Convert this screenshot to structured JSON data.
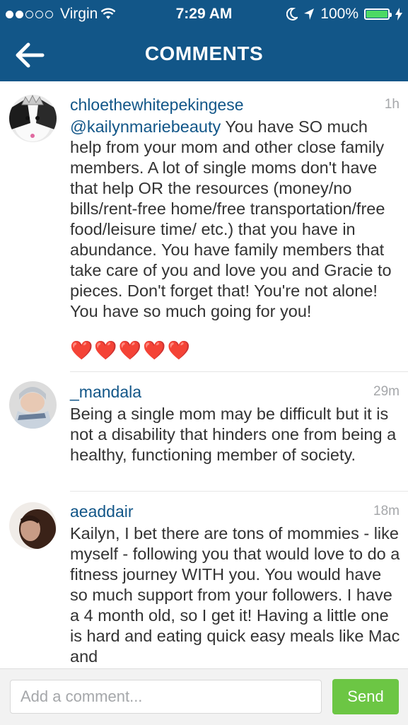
{
  "status_bar": {
    "carrier": "Virgin",
    "time": "7:29 AM",
    "battery": "100%",
    "battery_level": 1.0,
    "signal_dots": 5,
    "signal_filled": 2
  },
  "nav": {
    "title": "COMMENTS",
    "back_icon": "back-arrow-icon"
  },
  "comments": [
    {
      "username": "chloethewhitepekingese",
      "time": "1h",
      "mention": "@kailynmariebeauty",
      "text": " You have SO much help from your mom and other close family members. A lot of single moms don't have that help OR the resources (money/no bills/rent-free home/free transportation/free food/leisure time/ etc.) that you have in abundance. You have family members that take care of you and love you and Gracie to pieces. Don't forget that! You're not alone! You have so much going for you!",
      "emoji": "❤️❤️❤️❤️❤️"
    },
    {
      "username": "_mandala",
      "time": "29m",
      "text": "Being a single mom may be difficult but it is not a disability that hinders one from being a healthy, functioning member of society."
    },
    {
      "username": "aeaddair",
      "time": "18m",
      "text": "Kailyn, I bet there are tons of mommies - like myself - following you that would love to do a fitness journey WITH you. You would have so much support from your followers. I have a 4 month old, so I get it! Having a little one is hard and eating quick easy meals like Mac and"
    }
  ],
  "footer": {
    "placeholder": "Add a comment...",
    "send_label": "Send"
  },
  "colors": {
    "bar": "#125688",
    "username": "#125688",
    "send": "#6cc644",
    "heart": "#e0101e"
  }
}
